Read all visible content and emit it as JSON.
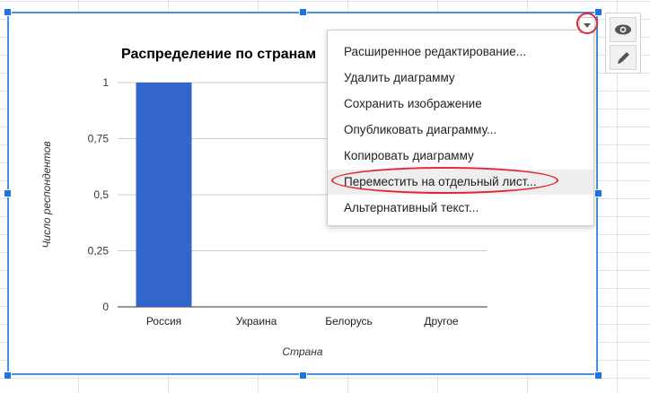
{
  "chart_data": {
    "type": "bar",
    "title": "Распределение по странам",
    "categories": [
      "Россия",
      "Украина",
      "Белорусь",
      "Другое"
    ],
    "values": [
      1,
      0,
      0,
      0
    ],
    "ylim": [
      0,
      1
    ],
    "yticks": [
      0,
      0.25,
      0.5,
      0.75,
      1
    ],
    "ytick_labels": [
      "0",
      "0,25",
      "0,5",
      "0,75",
      "1"
    ],
    "xlabel": "Страна",
    "ylabel": "Число респондентов",
    "bar_color": "#3366cc",
    "grid": true
  },
  "chart": {
    "title_visible": "Распределение по странам"
  },
  "menu": {
    "items": [
      {
        "label": "Расширенное редактирование..."
      },
      {
        "label": "Удалить диаграмму"
      },
      {
        "label": "Сохранить изображение"
      },
      {
        "label": "Опубликовать диаграмму..."
      },
      {
        "label": "Копировать диаграмму"
      },
      {
        "label": "Переместить на отдельный лист..."
      },
      {
        "label": "Альтернативный текст..."
      }
    ],
    "highlighted_index": 5
  },
  "side_panel": {
    "buttons": [
      {
        "icon": "eye-icon"
      },
      {
        "icon": "pencil-icon"
      }
    ]
  },
  "colors": {
    "selection": "#1a73e8",
    "annotation": "#e32636"
  }
}
